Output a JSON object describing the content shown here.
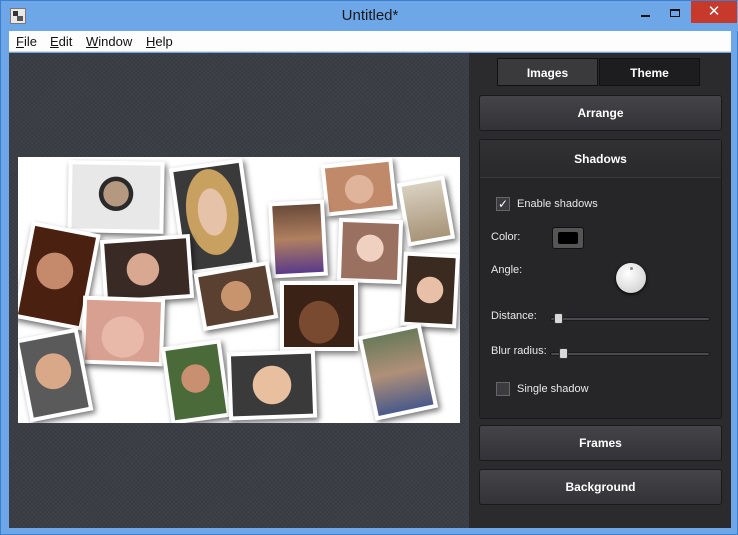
{
  "window": {
    "title": "Untitled*",
    "close_glyph": "✕"
  },
  "menu": {
    "items": [
      "File",
      "Edit",
      "Window",
      "Help"
    ],
    "mnemonics": [
      "F",
      "E",
      "W",
      "H"
    ]
  },
  "tabs": [
    {
      "label": "Images"
    },
    {
      "label": "Theme"
    }
  ],
  "sections": {
    "arrange": "Arrange",
    "shadows": "Shadows",
    "frames": "Frames",
    "background": "Background"
  },
  "shadows": {
    "enable_label": "Enable shadows",
    "enable_checked": true,
    "color_label": "Color:",
    "color_value": "#000000",
    "angle_label": "Angle:",
    "distance_label": "Distance:",
    "distance_value": 0.02,
    "blur_label": "Blur radius:",
    "blur_value": 0.05,
    "single_label": "Single shadow",
    "single_checked": false
  },
  "icons": {
    "check": "✓"
  },
  "colors": {
    "titlebar": "#6ea7e8",
    "close": "#c7392b",
    "panel": "#2b2b2e",
    "canvas": "#3b3e45"
  }
}
